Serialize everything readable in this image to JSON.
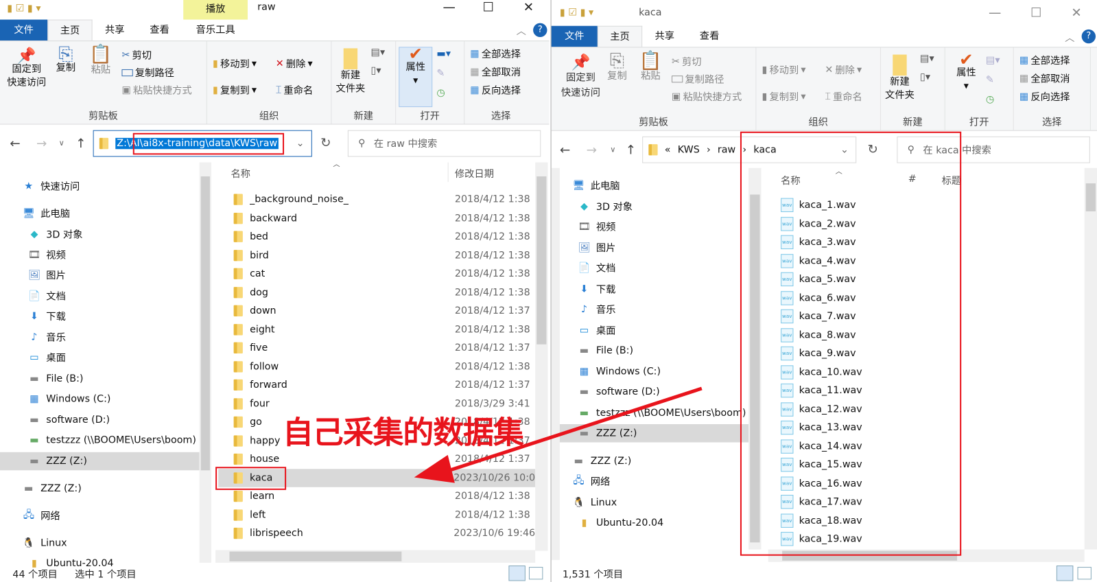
{
  "left": {
    "title": "raw",
    "context_tab": "播放",
    "tabs": [
      "文件",
      "主页",
      "共享",
      "查看",
      "音乐工具"
    ],
    "ribbon": {
      "clipboard": {
        "pin": "固定到",
        "pin2": "快速访问",
        "copy": "复制",
        "paste": "粘贴",
        "cut": "剪切",
        "copy_path": "复制路径",
        "paste_shortcut": "粘贴快捷方式",
        "label": "剪贴板"
      },
      "organize": {
        "move_to": "移动到",
        "delete": "删除",
        "copy_to": "复制到",
        "rename": "重命名",
        "label": "组织"
      },
      "new": {
        "new_folder": "新建",
        "new_folder2": "文件夹",
        "label": "新建"
      },
      "open": {
        "properties": "属性",
        "label": "打开"
      },
      "select": {
        "select_all": "全部选择",
        "select_none": "全部取消",
        "invert": "反向选择",
        "label": "选择"
      }
    },
    "address": "Z:\\AI\\ai8x-training\\data\\KWS\\raw",
    "search_placeholder": "在 raw 中搜索",
    "columns": {
      "name": "名称",
      "date": "修改日期"
    },
    "nav": [
      "快速访问",
      "此电脑",
      "3D 对象",
      "视频",
      "图片",
      "文档",
      "下载",
      "音乐",
      "桌面",
      "File (B:)",
      "Windows  (C:)",
      "software (D:)",
      "testzzz (\\\\BOOME\\Users\\boom)",
      "ZZZ (Z:)",
      "ZZZ (Z:)",
      "网络",
      "Linux",
      "Ubuntu-20.04"
    ],
    "files": [
      {
        "name": "_background_noise_",
        "date": "2018/4/12 1:38"
      },
      {
        "name": "backward",
        "date": "2018/4/12 1:38"
      },
      {
        "name": "bed",
        "date": "2018/4/12 1:38"
      },
      {
        "name": "bird",
        "date": "2018/4/12 1:38"
      },
      {
        "name": "cat",
        "date": "2018/4/12 1:38"
      },
      {
        "name": "dog",
        "date": "2018/4/12 1:38"
      },
      {
        "name": "down",
        "date": "2018/4/12 1:37"
      },
      {
        "name": "eight",
        "date": "2018/4/12 1:38"
      },
      {
        "name": "five",
        "date": "2018/4/12 1:37"
      },
      {
        "name": "follow",
        "date": "2018/4/12 1:38"
      },
      {
        "name": "forward",
        "date": "2018/4/12 1:37"
      },
      {
        "name": "four",
        "date": "2018/3/29 3:41"
      },
      {
        "name": "go",
        "date": "2018/4/12 1:38"
      },
      {
        "name": "happy",
        "date": "2018/4/12 1:37"
      },
      {
        "name": "house",
        "date": "2018/4/12 1:37"
      },
      {
        "name": "kaca",
        "date": "2023/10/26 10:0"
      },
      {
        "name": "learn",
        "date": "2018/4/12 1:38"
      },
      {
        "name": "left",
        "date": "2018/4/12 1:38"
      },
      {
        "name": "librispeech",
        "date": "2023/10/6 19:46"
      }
    ],
    "status": {
      "count": "44 个项目",
      "selected": "选中 1 个项目"
    }
  },
  "right": {
    "title": "kaca",
    "tabs": [
      "文件",
      "主页",
      "共享",
      "查看"
    ],
    "breadcrumb": [
      "«",
      "KWS",
      "raw",
      "kaca"
    ],
    "search_placeholder": "在 kaca 中搜索",
    "columns": {
      "name": "名称",
      "num": "#",
      "title": "标题"
    },
    "nav": [
      "此电脑",
      "3D 对象",
      "视频",
      "图片",
      "文档",
      "下载",
      "音乐",
      "桌面",
      "File (B:)",
      "Windows  (C:)",
      "software (D:)",
      "testzzz (\\\\BOOME\\Users\\boom)",
      "ZZZ (Z:)",
      "ZZZ (Z:)",
      "网络",
      "Linux",
      "Ubuntu-20.04"
    ],
    "files": [
      "kaca_1.wav",
      "kaca_2.wav",
      "kaca_3.wav",
      "kaca_4.wav",
      "kaca_5.wav",
      "kaca_6.wav",
      "kaca_7.wav",
      "kaca_8.wav",
      "kaca_9.wav",
      "kaca_10.wav",
      "kaca_11.wav",
      "kaca_12.wav",
      "kaca_13.wav",
      "kaca_14.wav",
      "kaca_15.wav",
      "kaca_16.wav",
      "kaca_17.wav",
      "kaca_18.wav",
      "kaca_19.wav"
    ],
    "status": {
      "count": "1,531 个项目"
    }
  },
  "annotation": {
    "text": "自己采集的数据集",
    "color": "#e8141c"
  },
  "colors": {
    "accent": "#1a64b4",
    "context_tab": "#f3f39a",
    "selection": "#0078d7"
  }
}
